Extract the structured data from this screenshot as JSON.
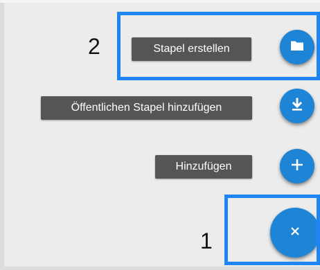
{
  "menu": {
    "items": [
      {
        "label": "Stapel erstellen",
        "icon": "folder-icon"
      },
      {
        "label": "Öffentlichen Stapel hinzufügen",
        "icon": "download-icon"
      },
      {
        "label": "Hinzufügen",
        "icon": "plus-icon"
      }
    ],
    "main_fab_icon": "close-icon"
  },
  "annotations": {
    "step_1": "1",
    "step_2": "2",
    "highlight_color": "#1f85f4"
  },
  "colors": {
    "fab": "#1e84d6",
    "chip": "#555555",
    "background": "#ececec"
  }
}
